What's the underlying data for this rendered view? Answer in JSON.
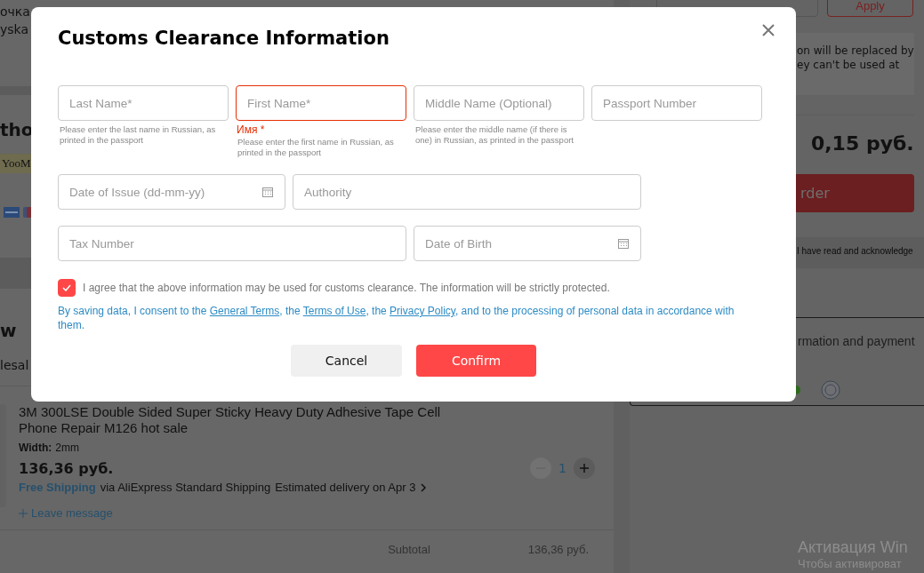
{
  "background": {
    "address_lines": [
      "очка",
      "yska"
    ],
    "payment_heading": "tho",
    "payment_badge": "YooM",
    "review_heading": "w",
    "seller": "lesal",
    "product": {
      "title": "3M 300LSE Double Sided Super Sticky Heavy Duty Adhesive Tape Cell Phone Repair M126 hot sale",
      "option_label": "Width:",
      "option_value": "2mm",
      "price": "136,36 руб.",
      "shipping_free": "Free Shipping",
      "shipping_method": "via AliExpress Standard Shipping",
      "delivery": "Estimated delivery on Apr 3",
      "leave_message": "Leave message",
      "quantity": "1"
    },
    "subtotal_label": "Subtotal",
    "subtotal_value": "136,36 руб.",
    "apply_button": "Apply",
    "coupon_note": [
      "on will be replaced by",
      "ey can't be used at"
    ],
    "total": "0,15 руб.",
    "order_button": "rder",
    "agreement": "I have read and acknowledge",
    "info_note": "rmation and payment"
  },
  "dialog": {
    "title": "Customs Clearance Information",
    "field_rows": [
      [
        {
          "kind": "text",
          "placeholder": "Last Name*",
          "invalid": false,
          "hint": "Please enter the last name in Russian, as printed in the passport"
        },
        {
          "kind": "text",
          "placeholder": "First Name*",
          "invalid": true,
          "error": "Имя *",
          "hint": "Please enter the first name in Russian, as printed in the passport"
        },
        {
          "kind": "text",
          "placeholder": "Middle Name (Optional)",
          "invalid": false,
          "hint": "Please enter the middle name (if there is one) in Russian, as printed in the passport"
        },
        {
          "kind": "text",
          "placeholder": "Passport Number",
          "invalid": false
        }
      ],
      [
        {
          "kind": "date",
          "placeholder": "Date of Issue (dd-mm-yy)",
          "invalid": false
        },
        {
          "kind": "text",
          "placeholder": "Authority",
          "invalid": false
        }
      ],
      [
        {
          "kind": "text",
          "placeholder": "Tax Number",
          "invalid": false
        },
        {
          "kind": "date",
          "placeholder": "Date of Birth",
          "invalid": false
        }
      ]
    ],
    "agree": {
      "checked": true,
      "label": "I agree that the above information may be used for customs clearance. The information will be strictly protected."
    },
    "consent": [
      {
        "kind": "text",
        "text": "By saving data, I consent to the "
      },
      {
        "kind": "link",
        "text": "General Terms"
      },
      {
        "kind": "text",
        "text": ", the "
      },
      {
        "kind": "link",
        "text": "Terms of Use"
      },
      {
        "kind": "text",
        "text": ", the "
      },
      {
        "kind": "link",
        "text": "Privacy Policy"
      },
      {
        "kind": "text",
        "text": ", and to the processing of personal data in accordance with them."
      }
    ],
    "buttons": [
      {
        "kind": "secondary",
        "label": "Cancel"
      },
      {
        "kind": "primary",
        "label": "Confirm"
      }
    ]
  },
  "os_notice": [
    "Активация Win",
    "Чтобы активироват"
  ]
}
